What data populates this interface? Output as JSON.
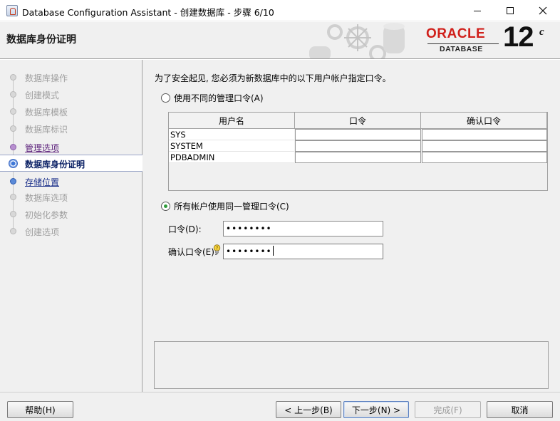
{
  "window": {
    "title": "Database Configuration Assistant - 创建数据库 - 步骤 6/10",
    "minimize_icon": "minimize-icon",
    "maximize_icon": "maximize-icon",
    "close_icon": "close-icon"
  },
  "header": {
    "page_title": "数据库身份证明",
    "brand_name": "ORACLE",
    "brand_sub": "DATABASE",
    "version": "12",
    "version_suffix": "c",
    "brand_color": "#d0201b"
  },
  "steps": [
    {
      "label": "数据库操作",
      "state": "done"
    },
    {
      "label": "创建模式",
      "state": "done"
    },
    {
      "label": "数据库模板",
      "state": "done"
    },
    {
      "label": "数据库标识",
      "state": "done"
    },
    {
      "label": "管理选项",
      "state": "link"
    },
    {
      "label": "数据库身份证明",
      "state": "current"
    },
    {
      "label": "存储位置",
      "state": "next"
    },
    {
      "label": "数据库选项",
      "state": "pending"
    },
    {
      "label": "初始化参数",
      "state": "pending"
    },
    {
      "label": "创建选项",
      "state": "pending"
    }
  ],
  "content": {
    "intro": "为了安全起见, 您必须为新数据库中的以下用户帐户指定口令。",
    "option_separate": "使用不同的管理口令(A)",
    "option_same": "所有帐户使用同一管理口令(C)",
    "selected_option": "same",
    "table": {
      "headers": [
        "用户名",
        "口令",
        "确认口令"
      ],
      "rows": [
        {
          "user": "SYS",
          "password": "",
          "confirm": ""
        },
        {
          "user": "SYSTEM",
          "password": "",
          "confirm": ""
        },
        {
          "user": "PDBADMIN",
          "password": "",
          "confirm": ""
        }
      ]
    },
    "password_label": "口令(D):",
    "password_value": "••••••••",
    "confirm_label": "确认口令(E):",
    "confirm_value": "••••••••",
    "hint_icon": "lightbulb-hint-icon"
  },
  "footer": {
    "help": "帮助(H)",
    "back": "< 上一步(B)",
    "next": "下一步(N) >",
    "finish": "完成(F)",
    "cancel": "取消"
  }
}
